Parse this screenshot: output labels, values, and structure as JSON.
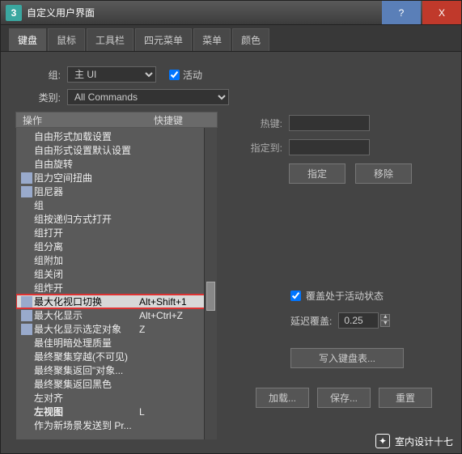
{
  "window": {
    "title": "自定义用户界面"
  },
  "winbtns": {
    "help": "?",
    "close": "X"
  },
  "tabs": [
    "键盘",
    "鼠标",
    "工具栏",
    "四元菜单",
    "菜单",
    "颜色"
  ],
  "active_tab": 0,
  "group": {
    "label": "组:",
    "value": "主 UI",
    "active_label": "活动"
  },
  "category": {
    "label": "类别:",
    "value": "All Commands"
  },
  "list": {
    "headers": {
      "action": "操作",
      "shortcut": "快捷键"
    },
    "items": [
      {
        "label": "自由形式加载设置",
        "shortcut": ""
      },
      {
        "label": "自由形式设置默认设置",
        "shortcut": ""
      },
      {
        "label": "自由旋转",
        "shortcut": ""
      },
      {
        "label": "阻力空间扭曲",
        "shortcut": "",
        "icon": true
      },
      {
        "label": "阻尼器",
        "shortcut": "",
        "icon": true
      },
      {
        "label": "组",
        "shortcut": ""
      },
      {
        "label": "组按递归方式打开",
        "shortcut": ""
      },
      {
        "label": "组打开",
        "shortcut": ""
      },
      {
        "label": "组分离",
        "shortcut": ""
      },
      {
        "label": "组附加",
        "shortcut": ""
      },
      {
        "label": "组关闭",
        "shortcut": ""
      },
      {
        "label": "组炸开",
        "shortcut": ""
      },
      {
        "label": "最大化视口切换",
        "shortcut": "Alt+Shift+1",
        "icon": true,
        "selected": true,
        "redbox": true
      },
      {
        "label": "最大化显示",
        "shortcut": "Alt+Ctrl+Z",
        "icon": true
      },
      {
        "label": "最大化显示选定对象",
        "shortcut": "Z",
        "icon": true
      },
      {
        "label": "最佳明暗处理质量",
        "shortcut": ""
      },
      {
        "label": "最终聚集穿越(不可见)",
        "shortcut": ""
      },
      {
        "label": "最终聚集返回\"对象...",
        "shortcut": ""
      },
      {
        "label": "最终聚集返回黑色",
        "shortcut": ""
      },
      {
        "label": "左对齐",
        "shortcut": ""
      },
      {
        "label": "左视图",
        "shortcut": "L",
        "bold": true
      },
      {
        "label": "作为新场景发送到 Pr...",
        "shortcut": ""
      }
    ]
  },
  "right": {
    "hotkey_label": "热键:",
    "assigned_label": "指定到:",
    "assign_btn": "指定",
    "remove_btn": "移除",
    "override_label": "覆盖处于活动状态",
    "delay_label": "延迟覆盖:",
    "delay_value": "0.25",
    "write_btn": "写入键盘表...",
    "load_btn": "加载...",
    "save_btn": "保存...",
    "reset_btn": "重置"
  },
  "watermark": "室内设计十七"
}
